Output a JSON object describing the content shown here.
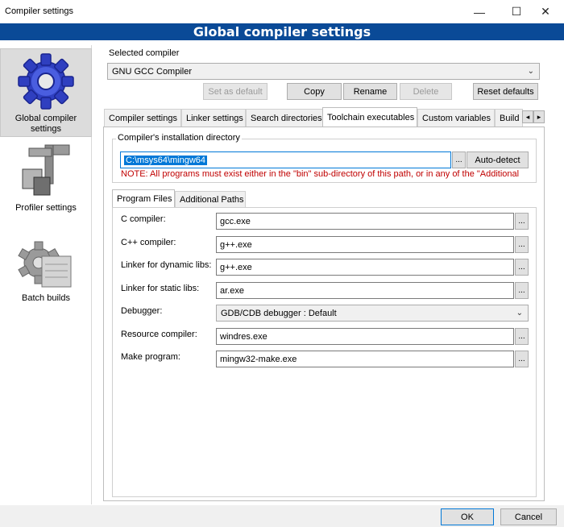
{
  "window": {
    "title": "Compiler settings",
    "minimize": "—",
    "maximize": "☐",
    "close": "✕"
  },
  "header": {
    "title": "Global compiler settings"
  },
  "sidebar": {
    "items": [
      {
        "label": "Global compiler settings",
        "icon": "gear-icon",
        "selected": true
      },
      {
        "label": "Profiler settings",
        "icon": "profiler-icon",
        "selected": false
      },
      {
        "label": "Batch builds",
        "icon": "batch-builds-icon",
        "selected": false
      }
    ]
  },
  "compiler": {
    "section_label": "Selected compiler",
    "selected": "GNU GCC Compiler",
    "buttons": {
      "set_default": "Set as default",
      "copy": "Copy",
      "rename": "Rename",
      "delete": "Delete",
      "reset": "Reset defaults"
    }
  },
  "tabs": {
    "items": [
      "Compiler settings",
      "Linker settings",
      "Search directories",
      "Toolchain executables",
      "Custom variables",
      "Build"
    ],
    "active": "Toolchain executables",
    "scroll_left": "◂",
    "scroll_right": "▸"
  },
  "install": {
    "group_label": "Compiler's installation directory",
    "path": "C:\\msys64\\mingw64",
    "browse": "...",
    "autodetect": "Auto-detect",
    "note": "NOTE: All programs must exist either in the \"bin\" sub-directory of this path, or in any of the \"Additional"
  },
  "subtabs": {
    "program_files": "Program Files",
    "additional_paths": "Additional Paths"
  },
  "programs": {
    "c_compiler": {
      "label": "C compiler:",
      "value": "gcc.exe"
    },
    "cpp_compiler": {
      "label": "C++ compiler:",
      "value": "g++.exe"
    },
    "linker_dynamic": {
      "label": "Linker for dynamic libs:",
      "value": "g++.exe"
    },
    "linker_static": {
      "label": "Linker for static libs:",
      "value": "ar.exe"
    },
    "debugger": {
      "label": "Debugger:",
      "value": "GDB/CDB debugger : Default"
    },
    "resource_compiler": {
      "label": "Resource compiler:",
      "value": "windres.exe"
    },
    "make_program": {
      "label": "Make program:",
      "value": "mingw32-make.exe"
    },
    "browse": "..."
  },
  "footer": {
    "ok": "OK",
    "cancel": "Cancel"
  },
  "colors": {
    "banner": "#0a4a97",
    "selection": "#0078d7",
    "note": "#c00000"
  }
}
